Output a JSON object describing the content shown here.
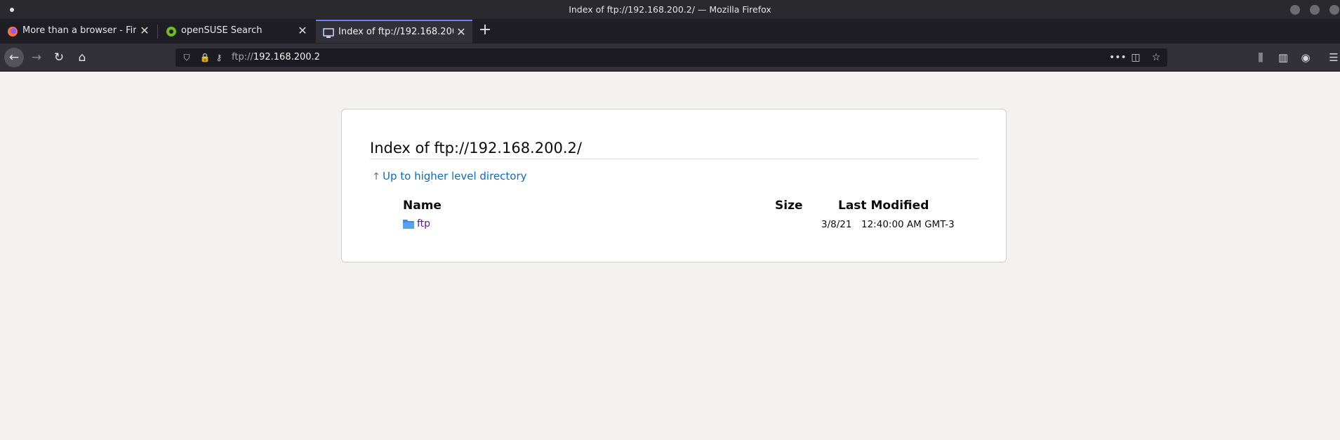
{
  "window": {
    "title": "Index of ftp://192.168.200.2/ — Mozilla Firefox"
  },
  "tabs": [
    {
      "label": "More than a browser - Fire",
      "icon": "firefox-icon"
    },
    {
      "label": "openSUSE Search",
      "icon": "opensuse-icon"
    },
    {
      "label": "Index of ftp://192.168.200",
      "icon": "ftp-index-icon",
      "active": true
    }
  ],
  "urlbar": {
    "scheme": "ftp://",
    "host": "192.168.200.2"
  },
  "page": {
    "heading": "Index of ftp://192.168.200.2/",
    "up_link": "Up to higher level directory",
    "columns": {
      "name": "Name",
      "size": "Size",
      "modified": "Last Modified"
    },
    "entries": [
      {
        "name": "ftp",
        "type": "folder",
        "size": "",
        "date": "3/8/21",
        "time": "12:40:00 AM GMT-3"
      }
    ]
  },
  "colors": {
    "link": "#0a6cc5",
    "visited": "#551a8b",
    "active_tab_accent": "#7a7aff"
  }
}
